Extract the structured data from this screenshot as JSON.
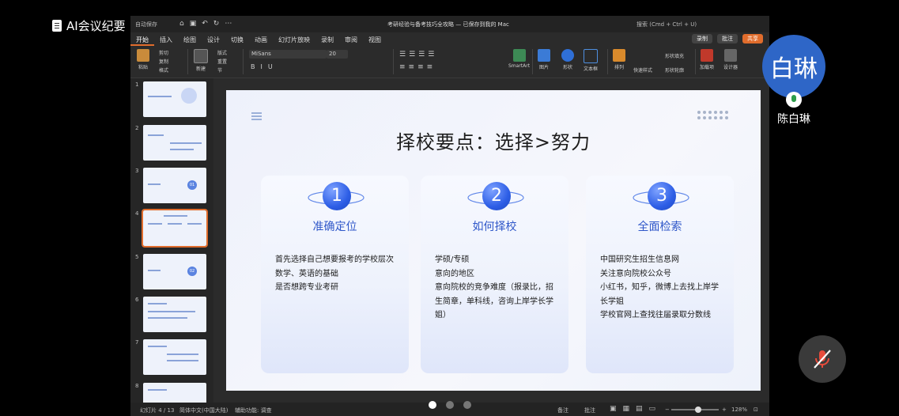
{
  "meeting": {
    "title": "AI会议纪要",
    "participant_initials": "白琳",
    "participant_name": "陈白琳"
  },
  "ppt": {
    "autosave": "自动保存",
    "doc_title": "考研经验与备考技巧全攻略 — 已保存到我的 Mac",
    "search": "搜索 (Cmd + Ctrl + U)",
    "tabs": [
      "开始",
      "插入",
      "绘图",
      "设计",
      "切换",
      "动画",
      "幻灯片放映",
      "录制",
      "审阅",
      "视图"
    ],
    "record_btn": "录制",
    "comment_btn": "批注",
    "share_btn": "共享",
    "ribbon": {
      "paste": "粘贴",
      "cut": "剪切",
      "copy": "复制",
      "format": "格式",
      "new_slide": "新建\n幻灯片",
      "layout": "版式",
      "reset": "重置",
      "section": "节",
      "font": "MiSans",
      "size": "20",
      "smartart": "转换为\nSmartArt",
      "picture": "图片",
      "shape": "形状",
      "textbox": "文本框",
      "arrange": "排列",
      "quick_styles": "快速样式",
      "shape_fill": "形状填充",
      "shape_outline": "形状轮廓",
      "addins": "加载项",
      "designer": "设计器"
    },
    "thumb_numbers": [
      "1",
      "2",
      "3",
      "4",
      "5",
      "6",
      "7",
      "8"
    ],
    "thumb_badges": [
      "01",
      "02"
    ],
    "status": {
      "slide": "幻灯片 4 / 13",
      "lang": "简体中文(中国大陆)",
      "accessibility": "辅助功能: 调查",
      "notes": "备注",
      "comments": "批注",
      "zoom": "128%"
    }
  },
  "slide": {
    "title": "择校要点：选择>努力",
    "cards": [
      {
        "num": "1",
        "title": "准确定位",
        "lines": [
          "首先选择自己想要报考的学校层次",
          "数学、英语的基础",
          "是否想跨专业考研"
        ]
      },
      {
        "num": "2",
        "title": "如何择校",
        "lines": [
          "学硕/专硕",
          "意向的地区",
          "意向院校的竞争难度（报录比，招",
          "生简章，单科线，咨询上岸学长学",
          "姐）"
        ]
      },
      {
        "num": "3",
        "title": "全面检索",
        "lines": [
          "中国研究生招生信息网",
          "关注意向院校公众号",
          "小红书，知乎，微博上去找上岸学",
          "长学姐",
          "学校官网上查找往届录取分数线"
        ]
      }
    ]
  },
  "colors": {
    "accent": "#e06c2c",
    "card_title": "#2f57c9",
    "avatar": "#2e66c7"
  }
}
